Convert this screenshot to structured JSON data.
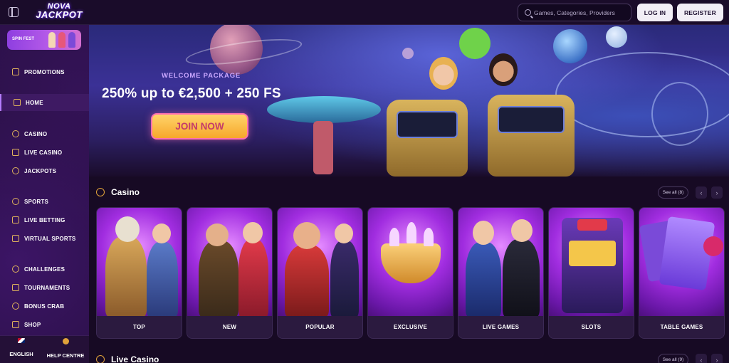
{
  "brand": {
    "logo_line1": "NOVA",
    "logo_line2": "JACKPOT"
  },
  "header": {
    "search_placeholder": "Games, Categories, Providers",
    "login_label": "LOG IN",
    "register_label": "REGISTER"
  },
  "sidebar": {
    "promo_label": "SPIN FEST",
    "items": [
      {
        "label": "PROMOTIONS",
        "icon": "gift-icon"
      },
      {
        "label": "HOME",
        "icon": "home-icon",
        "active": true
      },
      {
        "label": "CASINO",
        "icon": "casino-chip-icon"
      },
      {
        "label": "LIVE CASINO",
        "icon": "spade-icon"
      },
      {
        "label": "JACKPOTS",
        "icon": "jackpot-icon"
      },
      {
        "label": "SPORTS",
        "icon": "ball-icon"
      },
      {
        "label": "LIVE BETTING",
        "icon": "live-icon"
      },
      {
        "label": "VIRTUAL SPORTS",
        "icon": "gamepad-icon"
      },
      {
        "label": "CHALLENGES",
        "icon": "medal-icon"
      },
      {
        "label": "TOURNAMENTS",
        "icon": "trophy-icon"
      },
      {
        "label": "BONUS CRAB",
        "icon": "crab-icon"
      },
      {
        "label": "SHOP",
        "icon": "shop-icon"
      }
    ],
    "language_label": "ENGLISH",
    "help_label": "HELP CENTRE"
  },
  "hero": {
    "kicker": "WELCOME PACKAGE",
    "title": "250% up to €2,500 + 250 FS",
    "cta_label": "JOIN NOW"
  },
  "casino": {
    "title": "Casino",
    "see_all": "See all (8)",
    "cards": [
      {
        "label": "TOP"
      },
      {
        "label": "NEW"
      },
      {
        "label": "POPULAR"
      },
      {
        "label": "EXCLUSIVE"
      },
      {
        "label": "LIVE GAMES"
      },
      {
        "label": "SLOTS"
      },
      {
        "label": "TABLE GAMES"
      }
    ]
  },
  "live_casino": {
    "title": "Live Casino",
    "see_all": "See all (9)"
  },
  "colors": {
    "accent": "#b47cff",
    "gold": "#e0a23a",
    "cta": "#f6a72b",
    "bg": "#170a24"
  }
}
